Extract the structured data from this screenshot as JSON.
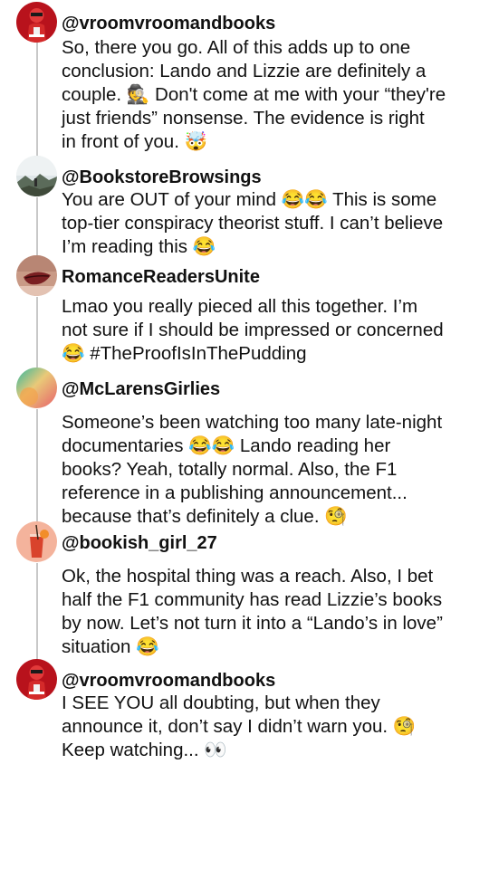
{
  "posts": [
    {
      "handle": "@vroomvroomandbooks",
      "avatar": "racing-driver-avatar",
      "text": "So, there you go. All of this adds up to one\nconclusion: Lando and Lizzie are definitely a\ncouple. 🕵️ Don't come at me with your “they're\njust friends” nonsense. The evidence is right\nin front of you. 🤯"
    },
    {
      "handle": "@BookstoreBrowsings",
      "avatar": "landscape-avatar",
      "text": "You are OUT of your mind 😂😂 This is some\ntop-tier conspiracy theorist stuff. I can’t believe\nI’m reading this 😂"
    },
    {
      "handle": "RomanceReadersUnite",
      "avatar": "lips-avatar",
      "text": "Lmao you really pieced all this together. I’m\nnot sure if I should be impressed or concerned\n😂 #TheProofIsInThePudding"
    },
    {
      "handle": "@McLarensGirlies",
      "avatar": "gradient-avatar",
      "text": "Someone’s been watching too many late-night\ndocumentaries 😂😂 Lando reading her\nbooks? Yeah, totally normal. Also, the F1\nreference in a publishing announcement...\nbecause that’s definitely a clue. 🧐"
    },
    {
      "handle": "@bookish_girl_27",
      "avatar": "cocktail-avatar",
      "text": "Ok, the hospital thing was a reach. Also, I bet\nhalf the F1 community has read Lizzie’s books\nby now. Let’s not turn it into a “Lando’s in love”\nsituation 😂"
    },
    {
      "handle": "@vroomvroomandbooks",
      "avatar": "racing-driver-avatar",
      "text": "I SEE YOU all doubting, but when they\nannounce it, don’t say I didn’t warn you. 🧐\nKeep watching... 👀"
    }
  ]
}
